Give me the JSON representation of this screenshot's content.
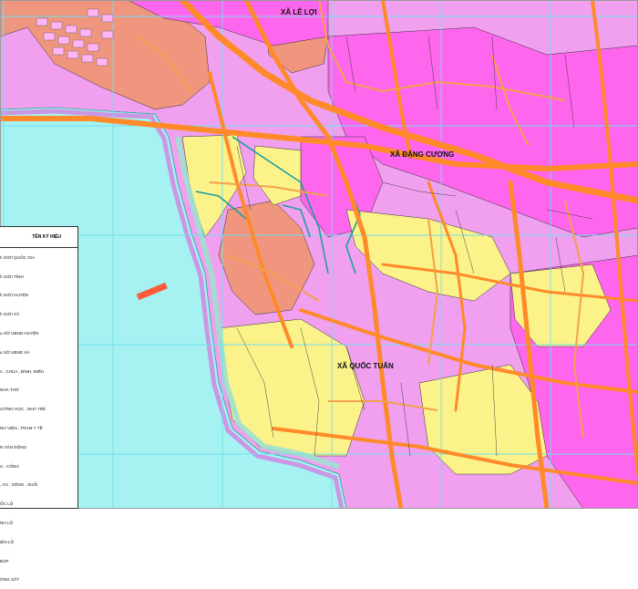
{
  "map": {
    "place_labels": [
      {
        "name": "label-xa-le-loi",
        "text": "XÃ LÊ LỢI"
      },
      {
        "name": "label-xa-dang-cuong",
        "text": "XÃ ĐẶNG CƯƠNG"
      },
      {
        "name": "label-xa-quoc-tuan",
        "text": "XÃ QUỐC TUẤN"
      }
    ],
    "colors": {
      "residential": "#f0a0ee",
      "urban": "#ff66ee",
      "agriculture": "#fbf28a",
      "water": "#a6f2f2",
      "road": "#f2a14c",
      "highway": "#ff8a2a",
      "mixed": "#f0967f",
      "grid": "#6fdff0"
    }
  },
  "legend": {
    "title": "TÊN KÝ HIỆU",
    "items": [
      "h GIỚI QUỐC GIA",
      "h GIỚI TỈNH",
      "h GIỚI HUYỆN",
      "h GIỚI XÃ",
      "ụ SỞ UBND HUYỆN",
      "ụ SỞ UBND XÃ",
      "n , CHÙA , ĐÌNH, MIẾU",
      "NHÀ THỜ",
      "ƯỜNG HỌC , NHÀ TRẺ",
      "NH VIỆN , TRẠM Y TẾ",
      "N VẬN ĐỘNG",
      "U , CỐNG",
      ", AO , SÔNG , SUỐI",
      "ỐC LỘ",
      "NH LỘ",
      "IỆN LỘ",
      "ĐẬP",
      "ỜNG SẮT"
    ]
  }
}
